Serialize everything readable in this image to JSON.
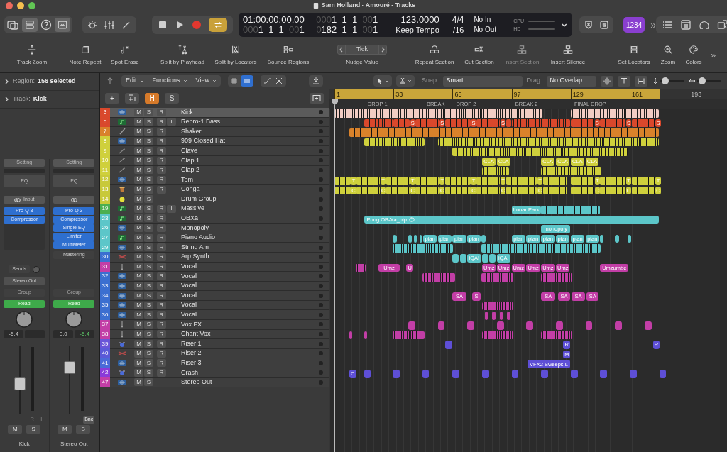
{
  "window": {
    "title": "Sam Holland - Amouré - Tracks"
  },
  "control_bar": {
    "transport": {
      "cycle_on": true
    },
    "lcd": {
      "timecode": "01:00:00:00.00",
      "position_top": [
        {
          "text": "000",
          "dim": true
        },
        {
          "text": "1  1  1  ",
          "dim": false
        },
        {
          "text": "00",
          "dim": true
        },
        {
          "text": "1",
          "dim": false
        }
      ],
      "position_bottom": [
        {
          "text": "000",
          "dim": true
        },
        {
          "text": "1  1  1  ",
          "dim": false
        },
        {
          "text": "00",
          "dim": true
        },
        {
          "text": "1",
          "dim": false
        }
      ],
      "length_bottom": [
        {
          "text": "0",
          "dim": true
        },
        {
          "text": "182  1  1  ",
          "dim": false
        },
        {
          "text": "00",
          "dim": true
        },
        {
          "text": "1",
          "dim": false
        }
      ],
      "tempo": "123.0000",
      "tempo_mode": "Keep Tempo",
      "signature": "4/4",
      "division": "/16",
      "midi_in": "No In",
      "midi_out": "No Out",
      "cpu_label": "CPU",
      "hd_label": "HD"
    },
    "count_in": "1234",
    "overflow": "»"
  },
  "toolbar": [
    {
      "label": "Track Zoom",
      "disabled": false
    },
    {
      "label": "Note Repeat",
      "disabled": false
    },
    {
      "label": "Spot Erase",
      "disabled": false
    },
    {
      "label": "Split by Playhead",
      "disabled": false
    },
    {
      "label": "Split by Locators",
      "disabled": false
    },
    {
      "label": "Bounce Regions",
      "disabled": false
    },
    {
      "label": "Nudge Value",
      "disabled": false,
      "value": "Tick"
    },
    {
      "label": "Repeat Section",
      "disabled": false
    },
    {
      "label": "Cut Section",
      "disabled": false
    },
    {
      "label": "Insert Section",
      "disabled": true
    },
    {
      "label": "Insert Silence",
      "disabled": false
    },
    {
      "label": "Set Locators",
      "disabled": false
    },
    {
      "label": "Zoom",
      "disabled": false
    },
    {
      "label": "Colors",
      "disabled": false
    }
  ],
  "toolbar_overflow": "»",
  "inspector": {
    "region": {
      "label": "Region:",
      "value": "156 selected"
    },
    "track": {
      "label": "Track:",
      "value": "Kick"
    },
    "strips": [
      {
        "setting": "Setting",
        "eq": "EQ",
        "input": "Input",
        "plugins": [
          "Pro-Q 3",
          "Compressor"
        ],
        "sends": "Sends",
        "output": "Stereo Out",
        "group": "Group",
        "automation": "Read",
        "values": [
          {
            "text": "-5.4",
            "kind": "volume"
          }
        ],
        "level": 0.42,
        "flags": [
          "R",
          "I"
        ],
        "mute": "M",
        "solo": "S",
        "name": "Kick"
      },
      {
        "setting": "Setting",
        "eq": "EQ",
        "plugins": [
          "Pro-Q 3",
          "Compressor",
          "Single EQ",
          "Limiter",
          "MultiMeter"
        ],
        "effect_label": "Mastering",
        "group": "Group",
        "automation": "Read",
        "values": [
          {
            "text": "0.0",
            "kind": "volume"
          },
          {
            "text": "-5.4",
            "kind": "peak"
          }
        ],
        "level": 0.72,
        "flags": [
          "Bnc"
        ],
        "mute": "M",
        "solo": "S",
        "name": "Stereo Out"
      }
    ]
  },
  "tracks_header": {
    "menus": [
      "Edit",
      "Functions",
      "View"
    ],
    "buttons": [
      {
        "label": "+",
        "selected": false
      },
      {
        "label": "H",
        "selected": true
      },
      {
        "label": "S",
        "selected": false
      }
    ]
  },
  "arrange_header": {
    "snap_label": "Snap:",
    "snap": "Smart",
    "drag_label": "Drag:",
    "drag": "No Overlap",
    "vertical_zoom": {
      "level": 0.1
    },
    "horizontal_zoom": {
      "level": 0.1
    }
  },
  "ruler": {
    "ticks": [
      "1",
      "33",
      "65",
      "97",
      "129",
      "161",
      "193"
    ]
  },
  "markers": [
    {
      "label": "DROP 1"
    },
    {
      "label": "BREAK"
    },
    {
      "label": "DROP 2"
    },
    {
      "label": "BREAK 2"
    },
    {
      "label": "FINAL DROP"
    }
  ],
  "tracks": [
    {
      "number": "3",
      "name": "Kick",
      "color": "#d9482c",
      "kind": "audio",
      "buttons": [
        "M",
        "S",
        "R"
      ],
      "selected": true,
      "regions": [
        {
          "kind": "dense"
        },
        {
          "kind": "dense"
        }
      ]
    },
    {
      "number": "6",
      "name": "Repro-1 Bass",
      "color": "#d9482c",
      "kind": "midi",
      "buttons": [
        "M",
        "S",
        "R",
        "I"
      ],
      "selected": false,
      "regions": [
        {
          "kind": "dense"
        },
        {
          "kind": "blocks"
        },
        {
          "kind": "region",
          "label": "S"
        },
        {
          "kind": "blocks"
        },
        {
          "kind": "region",
          "label": "S"
        },
        {
          "kind": "blocks"
        },
        {
          "kind": "region",
          "label": "S"
        },
        {
          "kind": "blocks"
        },
        {
          "kind": "region",
          "label": "S"
        },
        {
          "kind": "blocks"
        },
        {
          "kind": "dense"
        },
        {
          "kind": "blocks"
        },
        {
          "kind": "region",
          "label": "S"
        },
        {
          "kind": "blocks"
        },
        {
          "kind": "region",
          "label": "S"
        },
        {
          "kind": "blocks"
        },
        {
          "kind": "region",
          "label": "S"
        }
      ]
    },
    {
      "number": "7",
      "name": "Shaker",
      "color": "#d9822b",
      "kind": "pen",
      "buttons": [
        "M",
        "S",
        "R"
      ],
      "selected": false,
      "regions": [
        {
          "kind": "blocks"
        }
      ]
    },
    {
      "number": "8",
      "name": "909 Closed Hat",
      "color": "#cfd03c",
      "kind": "audio",
      "buttons": [
        "M",
        "S",
        "R"
      ],
      "selected": false,
      "regions": [
        {
          "kind": "dense"
        },
        {
          "kind": "dense"
        }
      ]
    },
    {
      "number": "9",
      "name": "Clave",
      "color": "#cfd03c",
      "kind": "stick",
      "buttons": [
        "M",
        "S",
        "R"
      ],
      "selected": false,
      "regions": [
        {
          "kind": "dense"
        }
      ]
    },
    {
      "number": "10",
      "name": "Clap 1",
      "color": "#cfd03c",
      "kind": "stick",
      "buttons": [
        "M",
        "S",
        "R"
      ],
      "selected": false,
      "regions": [
        {
          "kind": "region",
          "label": "CLA"
        },
        {
          "kind": "region",
          "label": "CLA"
        },
        {
          "kind": "region",
          "label": "CLA"
        },
        {
          "kind": "region",
          "label": "CLA"
        },
        {
          "kind": "region",
          "label": "CLA"
        },
        {
          "kind": "region",
          "label": "CLA"
        }
      ]
    },
    {
      "number": "11",
      "name": "Clap 2",
      "color": "#cfd03c",
      "kind": "stick",
      "buttons": [
        "M",
        "S",
        "R"
      ],
      "selected": false,
      "regions": [
        {
          "kind": "dense"
        },
        {
          "kind": "dense"
        }
      ]
    },
    {
      "number": "12",
      "name": "Tom",
      "color": "#c8c93a",
      "kind": "audio",
      "buttons": [
        "M",
        "S",
        "R"
      ],
      "selected": false,
      "regions": [
        {
          "kind": "blocks"
        },
        {
          "kind": "region",
          "label": "T"
        },
        {
          "kind": "blocks"
        },
        {
          "kind": "region",
          "label": "T"
        },
        {
          "kind": "blocks"
        },
        {
          "kind": "region",
          "label": "T"
        },
        {
          "kind": "blocks"
        },
        {
          "kind": "region",
          "label": "T"
        },
        {
          "kind": "blocks"
        },
        {
          "kind": "region",
          "label": "T"
        },
        {
          "kind": "blocks"
        },
        {
          "kind": "region",
          "label": "T"
        },
        {
          "kind": "blocks"
        },
        {
          "kind": "region",
          "label": "T"
        },
        {
          "kind": "blocks"
        },
        {
          "kind": "blocks"
        },
        {
          "kind": "region",
          "label": "T"
        },
        {
          "kind": "blocks"
        },
        {
          "kind": "region",
          "label": "T"
        },
        {
          "kind": "blocks"
        },
        {
          "kind": "region",
          "label": "T"
        }
      ]
    },
    {
      "number": "13",
      "name": "Conga",
      "color": "#c8c93a",
      "kind": "conga",
      "buttons": [
        "M",
        "S",
        "R"
      ],
      "selected": false,
      "regions": [
        {
          "kind": "blocks"
        },
        {
          "kind": "region",
          "label": "C"
        },
        {
          "kind": "blocks"
        },
        {
          "kind": "region",
          "label": "C"
        },
        {
          "kind": "blocks"
        },
        {
          "kind": "region",
          "label": "C"
        },
        {
          "kind": "blocks"
        },
        {
          "kind": "region",
          "label": "C"
        },
        {
          "kind": "blocks"
        },
        {
          "kind": "region",
          "label": "C"
        },
        {
          "kind": "blocks"
        },
        {
          "kind": "region",
          "label": "C"
        },
        {
          "kind": "blocks"
        },
        {
          "kind": "region",
          "label": "C"
        },
        {
          "kind": "blocks"
        },
        {
          "kind": "blocks"
        },
        {
          "kind": "region",
          "label": "C"
        },
        {
          "kind": "blocks"
        },
        {
          "kind": "region",
          "label": "C"
        },
        {
          "kind": "blocks"
        },
        {
          "kind": "region",
          "label": "C"
        }
      ]
    },
    {
      "number": "14",
      "name": "Drum Group",
      "color": "#c8c93a",
      "kind": "group",
      "buttons": [
        "M",
        "S"
      ],
      "selected": false
    },
    {
      "number": "19",
      "name": "Massive",
      "color": "#4caf50",
      "kind": "midi",
      "buttons": [
        "M",
        "S",
        "R",
        "I"
      ],
      "selected": false,
      "regions": [
        {
          "kind": "region",
          "label": "Lunar Park"
        },
        {
          "kind": "blocks"
        }
      ]
    },
    {
      "number": "23",
      "name": "OBXa",
      "color": "#5cc6c9",
      "kind": "midi",
      "buttons": [
        "M",
        "S",
        "R"
      ],
      "selected": false,
      "regions": [
        {
          "kind": "looped",
          "label": "Pong OB-Xa_bip"
        }
      ]
    },
    {
      "number": "26",
      "name": "Monopoly",
      "color": "#5cc6c9",
      "kind": "audio",
      "buttons": [
        "M",
        "S",
        "R"
      ],
      "selected": false,
      "regions": [
        {
          "kind": "region",
          "label": "monopoly"
        }
      ]
    },
    {
      "number": "27",
      "name": "Piano Audio",
      "color": "#5cc6c9",
      "kind": "midi",
      "buttons": [
        "M",
        "S",
        "R"
      ],
      "selected": false,
      "regions": [
        {
          "kind": "region"
        },
        {
          "kind": "region"
        },
        {
          "kind": "region"
        },
        {
          "kind": "region"
        },
        {
          "kind": "region",
          "label": "pian"
        },
        {
          "kind": "region",
          "label": "pian"
        },
        {
          "kind": "region",
          "label": "pian"
        },
        {
          "kind": "region",
          "label": "pian"
        },
        {
          "kind": "region"
        },
        {
          "kind": "region",
          "label": "pian"
        },
        {
          "kind": "region",
          "label": "pian"
        },
        {
          "kind": "region",
          "label": "pian"
        },
        {
          "kind": "region",
          "label": "pian"
        },
        {
          "kind": "region",
          "label": "pian"
        },
        {
          "kind": "region",
          "label": "pian"
        },
        {
          "kind": "region"
        },
        {
          "kind": "region"
        },
        {
          "kind": "region"
        }
      ]
    },
    {
      "number": "29",
      "name": "String Am",
      "color": "#5cc6c9",
      "kind": "audio",
      "buttons": [
        "M",
        "S",
        "R"
      ],
      "selected": false,
      "regions": [
        {
          "kind": "dense"
        },
        {
          "kind": "dense"
        }
      ]
    },
    {
      "number": "30",
      "name": "Arp Synth",
      "color": "#3b6fd0",
      "kind": "synth",
      "buttons": [
        "M",
        "S",
        "R"
      ],
      "selected": false,
      "regions": [
        {
          "kind": "region"
        },
        {
          "kind": "region"
        },
        {
          "kind": "region",
          "label": "iQA!"
        },
        {
          "kind": "region"
        },
        {
          "kind": "region"
        },
        {
          "kind": "region",
          "label": "iQA!"
        }
      ]
    },
    {
      "number": "31",
      "name": "Vocal",
      "color": "#c23ea6",
      "kind": "mic",
      "buttons": [
        "M",
        "S",
        "R"
      ],
      "selected": false,
      "regions": [
        {
          "kind": "dense"
        },
        {
          "kind": "region",
          "label": "Umz"
        },
        {
          "kind": "region",
          "label": "U"
        },
        {
          "kind": "region",
          "label": "Umz"
        },
        {
          "kind": "region",
          "label": "Umz"
        },
        {
          "kind": "region",
          "label": "Umz"
        },
        {
          "kind": "region",
          "label": "Umz"
        },
        {
          "kind": "region",
          "label": "Umz"
        },
        {
          "kind": "region",
          "label": "Umz"
        },
        {
          "kind": "region",
          "label": "Umzumbe"
        }
      ]
    },
    {
      "number": "32",
      "name": "Vocal",
      "color": "#3b6fd0",
      "kind": "audio",
      "buttons": [
        "M",
        "S",
        "R"
      ],
      "selected": false,
      "regions": [
        {
          "kind": "dense"
        },
        {
          "kind": "dense"
        },
        {
          "kind": "dense"
        }
      ]
    },
    {
      "number": "33",
      "name": "Vocal",
      "color": "#3b6fd0",
      "kind": "audio",
      "buttons": [
        "M",
        "S",
        "R"
      ],
      "selected": false
    },
    {
      "number": "34",
      "name": "Vocal",
      "color": "#3b6fd0",
      "kind": "audio",
      "buttons": [
        "M",
        "S",
        "R"
      ],
      "selected": false,
      "regions": [
        {
          "kind": "region",
          "label": "SA"
        },
        {
          "kind": "region",
          "label": "S"
        },
        {
          "kind": "region",
          "label": "SA"
        },
        {
          "kind": "region",
          "label": "SA"
        },
        {
          "kind": "region",
          "label": "SA"
        },
        {
          "kind": "region",
          "label": "SA"
        }
      ]
    },
    {
      "number": "35",
      "name": "Vocal",
      "color": "#3b6fd0",
      "kind": "audio",
      "buttons": [
        "M",
        "S",
        "R"
      ],
      "selected": false,
      "regions": [
        {
          "kind": "dense"
        }
      ]
    },
    {
      "number": "36",
      "name": "Vocal",
      "color": "#3b6fd0",
      "kind": "audio",
      "buttons": [
        "M",
        "S",
        "R"
      ],
      "selected": false,
      "regions": [
        {
          "kind": "region"
        },
        {
          "kind": "region"
        },
        {
          "kind": "region"
        },
        {
          "kind": "region"
        }
      ]
    },
    {
      "number": "37",
      "name": "Vox FX",
      "color": "#c23ea6",
      "kind": "mic",
      "buttons": [
        "M",
        "S",
        "R"
      ],
      "selected": false,
      "regions": [
        {
          "kind": "region"
        },
        {
          "kind": "region"
        },
        {
          "kind": "region"
        },
        {
          "kind": "region"
        },
        {
          "kind": "region"
        },
        {
          "kind": "region"
        },
        {
          "kind": "region"
        },
        {
          "kind": "region"
        },
        {
          "kind": "region"
        }
      ]
    },
    {
      "number": "38",
      "name": "Chant Vox",
      "color": "#c23ea6",
      "kind": "mic",
      "buttons": [
        "M",
        "S",
        "R"
      ],
      "selected": false,
      "regions": [
        {
          "kind": "region"
        },
        {
          "kind": "region"
        },
        {
          "kind": "dense"
        },
        {
          "kind": "dense"
        },
        {
          "kind": "dense"
        }
      ]
    },
    {
      "number": "39",
      "name": "Riser 1",
      "color": "#6a55d8",
      "kind": "drumkit",
      "buttons": [
        "M",
        "S",
        "R"
      ],
      "selected": false,
      "regions": [
        {
          "kind": "region"
        },
        {
          "kind": "region",
          "label": "R"
        },
        {
          "kind": "region",
          "label": "R"
        }
      ]
    },
    {
      "number": "40",
      "name": "Riser 2",
      "color": "#5a5ad8",
      "kind": "synth",
      "buttons": [
        "M",
        "S",
        "R"
      ],
      "selected": false,
      "regions": [
        {
          "kind": "region",
          "label": "M"
        }
      ]
    },
    {
      "number": "41",
      "name": "Riser 3",
      "color": "#4a6ad8",
      "kind": "audio",
      "buttons": [
        "M",
        "S",
        "R"
      ],
      "selected": false,
      "regions": [
        {
          "kind": "region",
          "label": "VFX2 Sweeps L"
        }
      ]
    },
    {
      "number": "42",
      "name": "Crash",
      "color": "#8a3ad8",
      "kind": "drumkit",
      "buttons": [
        "M",
        "S",
        "R"
      ],
      "selected": false,
      "regions": [
        {
          "kind": "region",
          "label": "C"
        },
        {
          "kind": "region"
        },
        {
          "kind": "region"
        },
        {
          "kind": "region"
        },
        {
          "kind": "region"
        },
        {
          "kind": "region"
        },
        {
          "kind": "region"
        },
        {
          "kind": "region"
        },
        {
          "kind": "region"
        },
        {
          "kind": "region"
        },
        {
          "kind": "region"
        },
        {
          "kind": "region"
        }
      ]
    },
    {
      "number": "47",
      "name": "Stereo Out",
      "color": "#c23ea6",
      "kind": "audio",
      "buttons": [
        "M",
        "S"
      ],
      "selected": false
    }
  ]
}
